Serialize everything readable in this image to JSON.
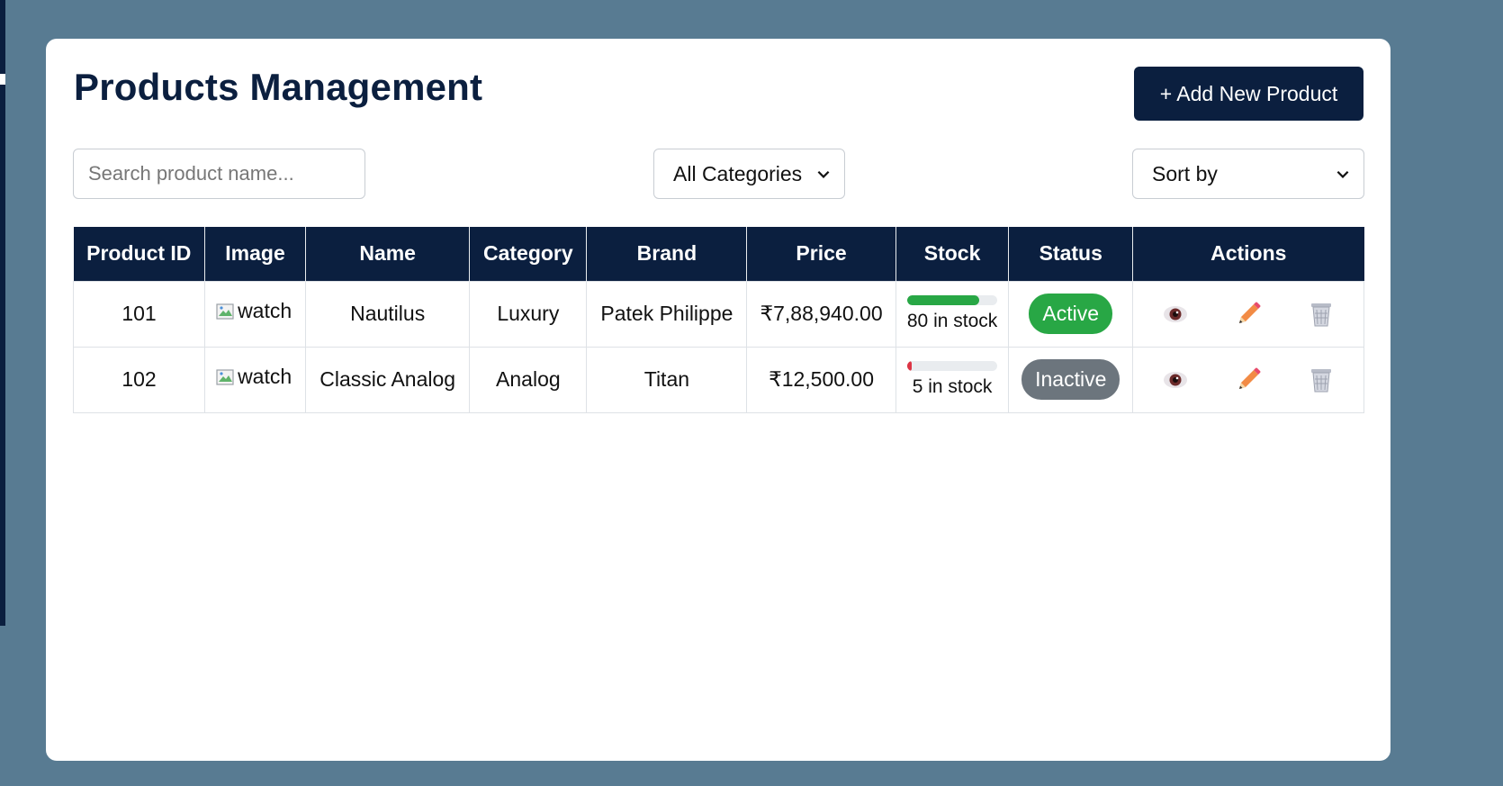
{
  "header": {
    "title": "Products Management",
    "add_button_label": "+ Add New Product"
  },
  "filters": {
    "search_placeholder": "Search product name...",
    "category_selected": "All Categories",
    "sort_selected": "Sort by"
  },
  "table": {
    "columns": [
      "Product ID",
      "Image",
      "Name",
      "Category",
      "Brand",
      "Price",
      "Stock",
      "Status",
      "Actions"
    ],
    "rows": [
      {
        "id": "101",
        "image_alt": "watch",
        "name": "Nautilus",
        "category": "Luxury",
        "brand": "Patek Philippe",
        "price": "₹7,88,940.00",
        "stock_fraction": 0.8,
        "stock_color": "#28a745",
        "stock_text": "80 in stock",
        "status": "Active",
        "status_color": "#28a745"
      },
      {
        "id": "102",
        "image_alt": "watch",
        "name": "Classic Analog",
        "category": "Analog",
        "brand": "Titan",
        "price": "₹12,500.00",
        "stock_fraction": 0.05,
        "stock_color": "#dc3545",
        "stock_text": "5 in stock",
        "status": "Inactive",
        "status_color": "#6c757d"
      }
    ],
    "action_icons": [
      "eye-icon",
      "pencil-icon",
      "trash-icon"
    ]
  },
  "colors": {
    "primary": "#0b1f3f",
    "background": "#587b92",
    "active": "#28a745",
    "inactive": "#6c757d",
    "low_stock": "#dc3545"
  }
}
